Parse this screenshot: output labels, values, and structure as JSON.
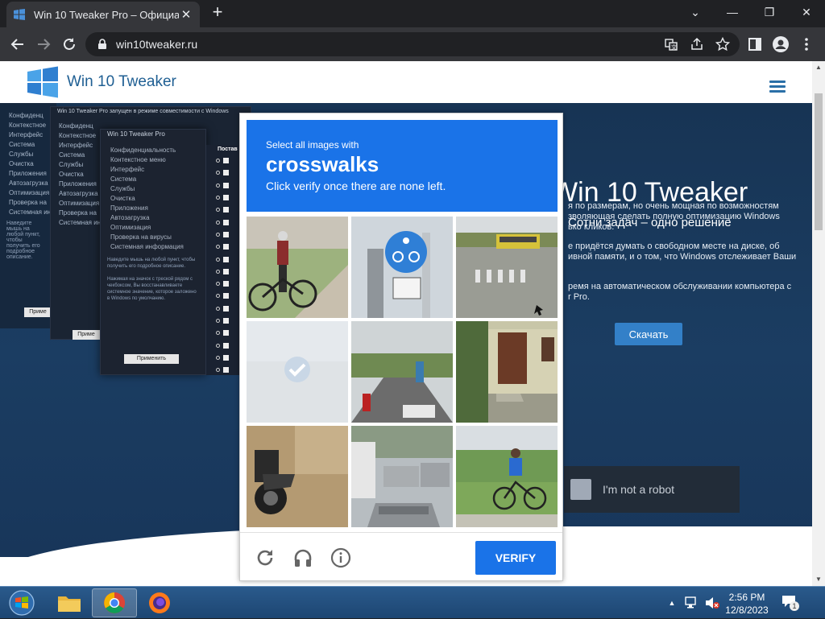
{
  "browser": {
    "tab_title": "Win 10 Tweaker Pro – Официал",
    "new_tab_label": "+",
    "url": "win10tweaker.ru"
  },
  "site": {
    "brand": "Win 10 Tweaker",
    "hero_title": "Win 10 Tweaker",
    "hero_subtitle": "Сотни задач – одно решение",
    "paragraphs": [
      "я по размерам, но очень мощная по возможностям\nзволяющая сделать полную оптимизацию Windows\nько кликов.",
      "е придётся думать о свободном месте на диске, об\nивной памяти, и о том, что Windows отслеживает Ваши",
      "ремя на автоматическом обслуживании компьютера с\nr Pro."
    ],
    "download_label": "Скачать",
    "not_robot_label": "I'm not a robot"
  },
  "app_window": {
    "title": "Win 10 Tweaker Pro запущен в режиме совместимости с Windows",
    "menu": [
      "Конфиденциальность",
      "Контекстное меню",
      "Интерфейс",
      "Система",
      "Службы",
      "Очистка",
      "Приложения",
      "Автозагрузка",
      "Оптимизация",
      "Проверка на вирусы",
      "Системная информация"
    ],
    "menu_short": [
      "Конфиденц",
      "Контекстное",
      "Интерфейс",
      "Система",
      "Службы",
      "Очистка",
      "Приложения",
      "Автозагрузка",
      "Оптимизация",
      "Проверка на",
      "Системная ин"
    ],
    "hint": "Наведите мышь на любой пункт, чтобы получить его подробное описание.",
    "hint2": "Нажимая на значок с треской рядом с чекбоксом, Вы восстанавливаете системное значение, которое заложено в Windows по умолчанию.",
    "apply_label": "Применить",
    "apply_short": "Приме",
    "second_title": "Win 10 Tweaker Pro",
    "column_head": "Постав"
  },
  "captcha": {
    "line1": "Select all images with",
    "target": "crosswalks",
    "line3": "Click verify once there are none left.",
    "verify_label": "VERIFY",
    "tiles": [
      {
        "scene": "man-with-bicycle",
        "selected": false
      },
      {
        "scene": "bicycle-sign",
        "selected": false
      },
      {
        "scene": "crosswalk-bus",
        "selected": false
      },
      {
        "scene": "selected-blank",
        "selected": true
      },
      {
        "scene": "road-scooter",
        "selected": false
      },
      {
        "scene": "house-door",
        "selected": false
      },
      {
        "scene": "motorcycle",
        "selected": false
      },
      {
        "scene": "street-cars",
        "selected": false
      },
      {
        "scene": "cyclist-blue",
        "selected": false
      }
    ],
    "icons": [
      "reload-icon",
      "audio-icon",
      "info-icon"
    ]
  },
  "taskbar": {
    "time": "2:56 PM",
    "date": "12/8/2023",
    "notification_count": "1"
  },
  "colors": {
    "captcha_blue": "#1a73e8",
    "hero_bg": "#173454",
    "chrome_dark": "#202124"
  }
}
